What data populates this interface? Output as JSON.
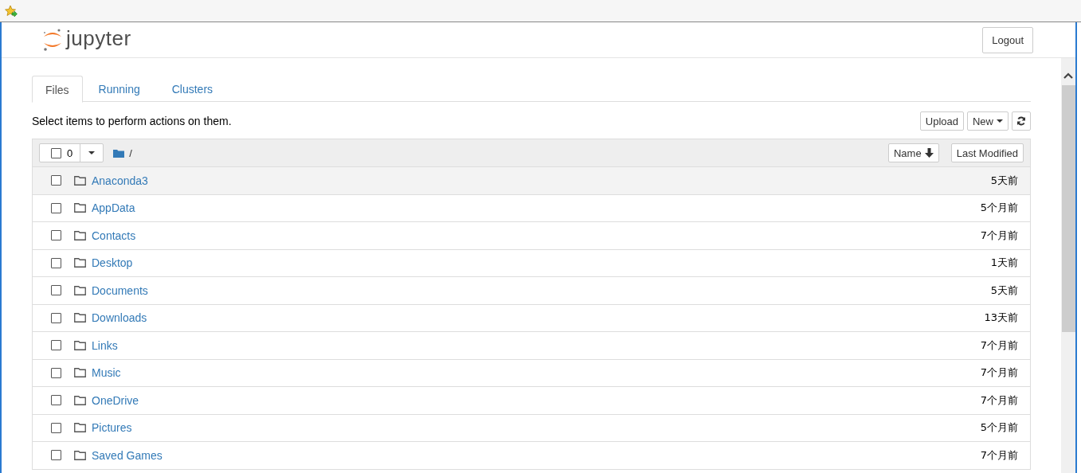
{
  "header": {
    "logo_text": "jupyter",
    "logout": "Logout"
  },
  "tabs": [
    {
      "label": "Files",
      "selected": true
    },
    {
      "label": "Running",
      "selected": false
    },
    {
      "label": "Clusters",
      "selected": false
    }
  ],
  "toolbar": {
    "hint": "Select items to perform actions on them.",
    "buttons": [
      "Upload",
      "New"
    ]
  },
  "list_header": {
    "checked": false,
    "selected_count": "0",
    "path": "/",
    "sort_buttons": [
      "Name",
      "Last Modified"
    ]
  },
  "rows": [
    {
      "name": "Anaconda3",
      "modified": "5天前",
      "checked": false,
      "highlighted": true
    },
    {
      "name": "AppData",
      "modified": "5个月前",
      "checked": false,
      "highlighted": false
    },
    {
      "name": "Contacts",
      "modified": "7个月前",
      "checked": false,
      "highlighted": false
    },
    {
      "name": "Desktop",
      "modified": "1天前",
      "checked": false,
      "highlighted": false
    },
    {
      "name": "Documents",
      "modified": "5天前",
      "checked": false,
      "highlighted": false
    },
    {
      "name": "Downloads",
      "modified": "13天前",
      "checked": false,
      "highlighted": false
    },
    {
      "name": "Links",
      "modified": "7个月前",
      "checked": false,
      "highlighted": false
    },
    {
      "name": "Music",
      "modified": "7个月前",
      "checked": false,
      "highlighted": false
    },
    {
      "name": "OneDrive",
      "modified": "7个月前",
      "checked": false,
      "highlighted": false
    },
    {
      "name": "Pictures",
      "modified": "5个月前",
      "checked": false,
      "highlighted": false
    },
    {
      "name": "Saved Games",
      "modified": "7个月前",
      "checked": false,
      "highlighted": false
    }
  ]
}
